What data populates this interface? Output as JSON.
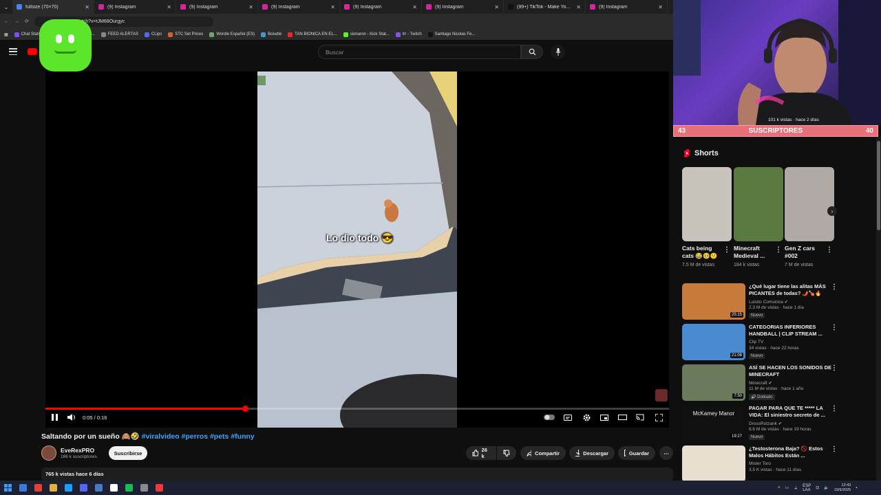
{
  "browser": {
    "tabs": [
      {
        "label": "fullsize (70×70)",
        "color": "#4285f4"
      },
      {
        "label": "(9) Instagram",
        "color": "#d6249f"
      },
      {
        "label": "(9) Instagram",
        "color": "#d6249f"
      },
      {
        "label": "(9) Instagram",
        "color": "#d6249f"
      },
      {
        "label": "(9) Instagram",
        "color": "#d6249f"
      },
      {
        "label": "(9) Instagram",
        "color": "#d6249f"
      },
      {
        "label": "(99+) TikTok - Make Your Day",
        "color": "#111111"
      },
      {
        "label": "(9) Instagram",
        "color": "#d6249f"
      }
    ],
    "url": "watch?v=tJM68Ourgyc",
    "bookmarks": [
      {
        "label": "Chat Stats",
        "color": "#7c4dff"
      },
      {
        "label": "CS:GO Stash - Brow...",
        "color": "#e0a030"
      },
      {
        "label": "FEED ALERTAS",
        "color": "#888888"
      },
      {
        "label": "CLips",
        "color": "#4a6cf7"
      },
      {
        "label": "STC Set Prices",
        "color": "#e05a2a"
      },
      {
        "label": "Wordle Español (ES)",
        "color": "#6aaa64"
      },
      {
        "label": "Boludle",
        "color": "#3a9ad9"
      },
      {
        "label": "TAN BIONICA EN EL...",
        "color": "#ff2020"
      },
      {
        "label": "sionaron - Kick Stat...",
        "color": "#53fc18"
      },
      {
        "label": "trr - Twitch",
        "color": "#9146ff"
      },
      {
        "label": "Santiago Nicolas Fe...",
        "color": "#111111"
      }
    ]
  },
  "youtube": {
    "search_placeholder": "Buscar",
    "video": {
      "overlay_text": "Lo dio todo 😎",
      "time": "0:05 / 0:16",
      "progress": 0.32,
      "title_main": "Saltando por un sueño 🙈🤣",
      "title_tags": "#viralvideo #perros #pets #funny",
      "channel": "EveRexPRO",
      "subscribers": "166 k suscriptores",
      "subscribe_label": "Suscribirse",
      "likes": "26 k",
      "share_label": "Compartir",
      "download_label": "Descargar",
      "save_label": "Guardar",
      "views_line": "765 k vistas  hace 6 días"
    },
    "shorts_header": "Shorts",
    "shorts": [
      {
        "title": "Cats being cats 😂🥺🙂",
        "views": "7.5 M de vistas",
        "bg": "#c8c4bc"
      },
      {
        "title": "Minecraft Medieval ...",
        "views": "184 k vistas",
        "bg": "#5a7a40"
      },
      {
        "title": "Gen Z cars #002",
        "views": "7 M de vistas",
        "bg": "#b0aaa6"
      }
    ],
    "recommended": [
      {
        "title": "¿Qué lugar tiene las alitas MÁS PICANTES de todas? 🌶️🍗🔥",
        "channel": "Luisito Comunica ✔",
        "views": "2.3 M de vistas · hace 1 día",
        "badge": "Nuevo",
        "duration": "25:15",
        "bg": "#c87a3a"
      },
      {
        "title": "CATEGORIAS INFERIORES HANDBALL | CLIP STREAM ...",
        "channel": "Clip TV",
        "views": "34 vistas · hace 22 horas",
        "badge": "Nuevo",
        "duration": "21:08",
        "bg": "#4a8ad0"
      },
      {
        "title": "ASÍ SE HACEN LOS SONIDOS DE MINECRAFT",
        "channel": "Minecraft ✔",
        "views": "11 M de vistas · hace 1 año",
        "badge": "🔊 Doblado",
        "duration": "7:50",
        "bg": "#6a7a5a"
      },
      {
        "title": "PAGAR PARA QUE TE ***** LA VIDA: El siniestro secreto de ...",
        "channel": "DrossRotzank ✔",
        "views": "6.6 M de vistas · hace 19 horas",
        "badge": "Nuevo",
        "duration": "19:27",
        "bg": "#101010",
        "thumb_text": "McKamey Manor"
      },
      {
        "title": "¿Testosterona Baja? 🚫 Estos Malos Hábitos Están ...",
        "channel": "Mister Toro",
        "views": "3.5 K vistas · hace 11 días",
        "badge": "",
        "duration": "",
        "bg": "#e8e0d0"
      }
    ]
  },
  "stream": {
    "subs_left": "43",
    "subs_label": "SUSCRIPTORES",
    "subs_right": "40",
    "mini_info": "101 k vistas · hace 2 días"
  },
  "taskbar": {
    "lang": "ESP\nLAA",
    "time": "13:43",
    "date": "19/9/2025",
    "apps": [
      "#3a7bd5",
      "#e34133",
      "#e0b040",
      "#1a9fff",
      "#5865f2",
      "#4a7ac0",
      "#ffffff",
      "#1db954",
      "#8a8a8a",
      "#ee3a3a"
    ]
  }
}
